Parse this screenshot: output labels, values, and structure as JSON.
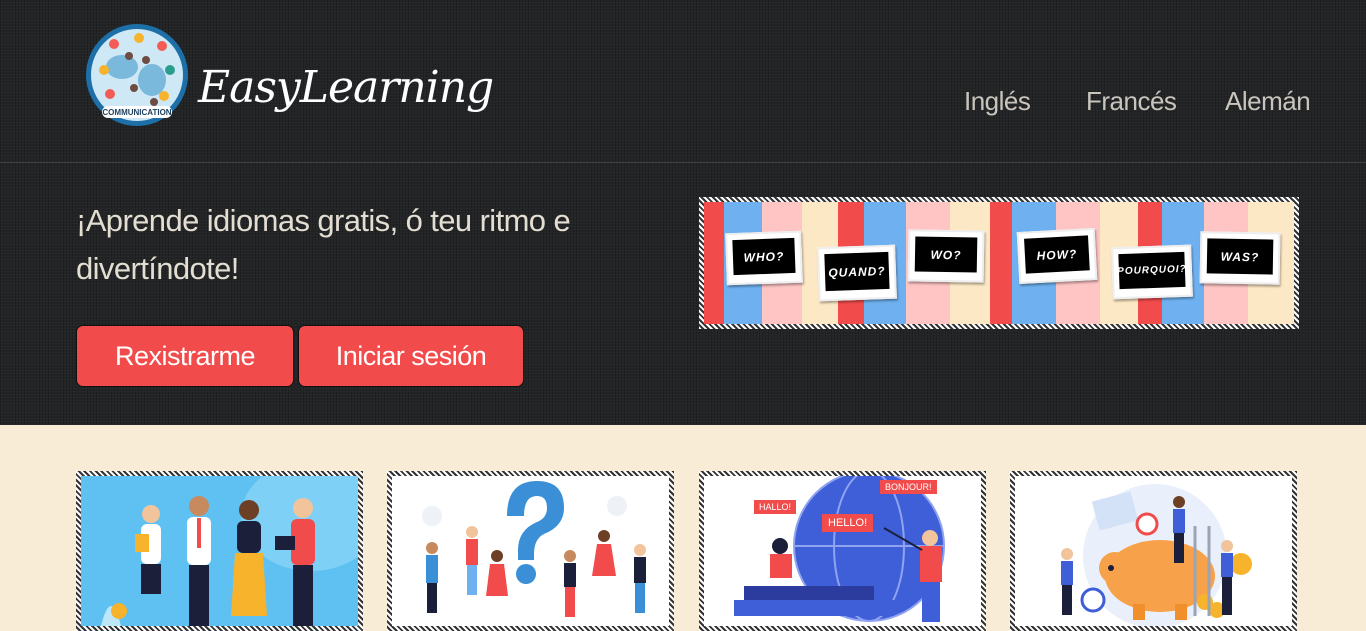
{
  "header": {
    "brand": "EasyLearning",
    "logo_text": "COMMUNICATION",
    "nav": [
      "Inglés",
      "Francés",
      "Alemán"
    ]
  },
  "hero": {
    "tagline": "¡Aprende idiomas gratis, ó teu ritmo e divertíndote!",
    "register_label": "Rexistrarme",
    "login_label": "Iniciar sesión",
    "banner_cards": [
      "WHO?",
      "QUAND?",
      "WO?",
      "HOW?",
      "POURQUOI?",
      "WAS?"
    ]
  },
  "cards": {
    "card3_bubbles": [
      "HALLO!",
      "HELLO!",
      "BONJOUR!"
    ]
  },
  "colors": {
    "accent": "#f24b4b",
    "dark_bg": "#222426",
    "cream_bg": "#f8ecd6"
  }
}
